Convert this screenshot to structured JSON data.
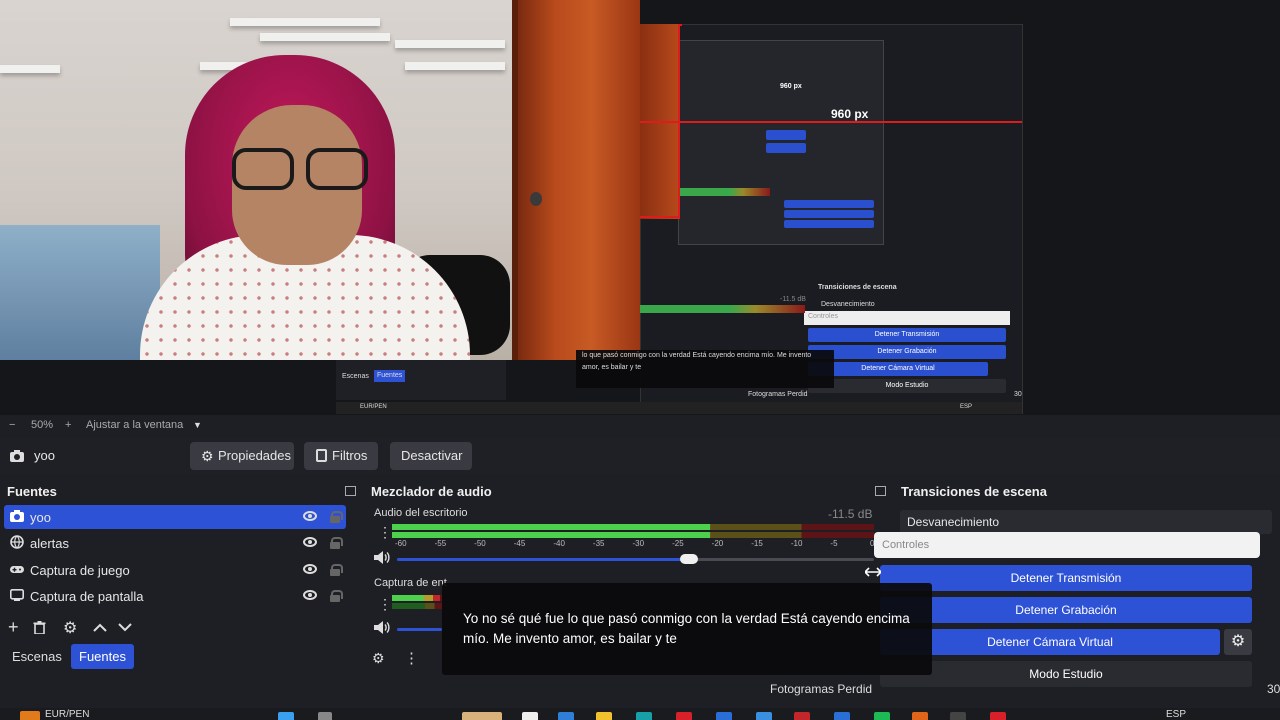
{
  "preview": {
    "nested_label_large": "960 px",
    "nested_label_small": "960 px",
    "nested_transitions_title": "Transiciones de escena",
    "nested_fade": "Desvanecimiento",
    "nested_controls": "Controles",
    "nested_stop_stream": "Detener Transmisión",
    "nested_stop_record": "Detener Grabación",
    "nested_stop_vcam": "Detener Cámara Virtual",
    "nested_studio": "Modo Estudio",
    "nested_db": "-11.5 dB",
    "nested_subtitle": "lo que pasó conmigo con la verdad Está cayendo encima mío. Me invento amor, es bailar y te",
    "nested_fps": "Fotogramas Perdid",
    "nested_tab_scenes": "Escenas",
    "nested_tab_sources": "Fuentes",
    "nested_currency": "EUR/PEN",
    "nested_lang": "ESP",
    "nested_num": "30"
  },
  "zoom_row": {
    "minus": "−",
    "zoom": "50%",
    "plus": "+",
    "fit": "Ajustar a la ventana",
    "caret": "▼"
  },
  "source_toolbar": {
    "source_name": "yoo",
    "properties": "Propiedades",
    "filters": "Filtros",
    "deactivate": "Desactivar"
  },
  "sources_dock": {
    "title": "Fuentes",
    "items": [
      {
        "label": "yoo",
        "icon": "camera-icon",
        "active": true
      },
      {
        "label": "alertas",
        "icon": "globe-icon",
        "active": false
      },
      {
        "label": "Captura de juego",
        "icon": "gamepad-icon",
        "active": false
      },
      {
        "label": "Captura de pantalla",
        "icon": "monitor-icon",
        "active": false
      }
    ],
    "tab_scenes": "Escenas",
    "tab_sources": "Fuentes"
  },
  "mixer_dock": {
    "title": "Mezclador de audio",
    "channel1": {
      "name": "Audio del escritorio",
      "db": "-11.5 dB",
      "level": 0.66
    },
    "channel2": {
      "name": "Captura de ent",
      "level": 0.1
    },
    "ticks": [
      "-60",
      "-55",
      "-50",
      "-45",
      "-40",
      "-35",
      "-30",
      "-25",
      "-20",
      "-15",
      "-10",
      "-5",
      "0"
    ]
  },
  "transitions_dock": {
    "title": "Transiciones de escena",
    "fade": "Desvanecimiento"
  },
  "controls": {
    "title": "Controles",
    "stop_stream": "Detener Transmisión",
    "stop_record": "Detener Grabación",
    "stop_vcam": "Detener Cámara Virtual",
    "studio_mode": "Modo Estudio"
  },
  "subtitle": {
    "text": "Yo no sé qué fue lo que pasó conmigo con la verdad Está cayendo encima mío. Me invento amor, es bailar y te"
  },
  "status": {
    "fps": "Fotogramas Perdid",
    "num": "30"
  },
  "taskbar": {
    "currency": "EUR/PEN",
    "lang": "ESP"
  },
  "colors": {
    "accent": "#2e52d6",
    "background": "#1e1f24",
    "meter_green": "#4dd14d",
    "meter_yellow": "#b39d2b",
    "meter_red": "#c0262a"
  }
}
